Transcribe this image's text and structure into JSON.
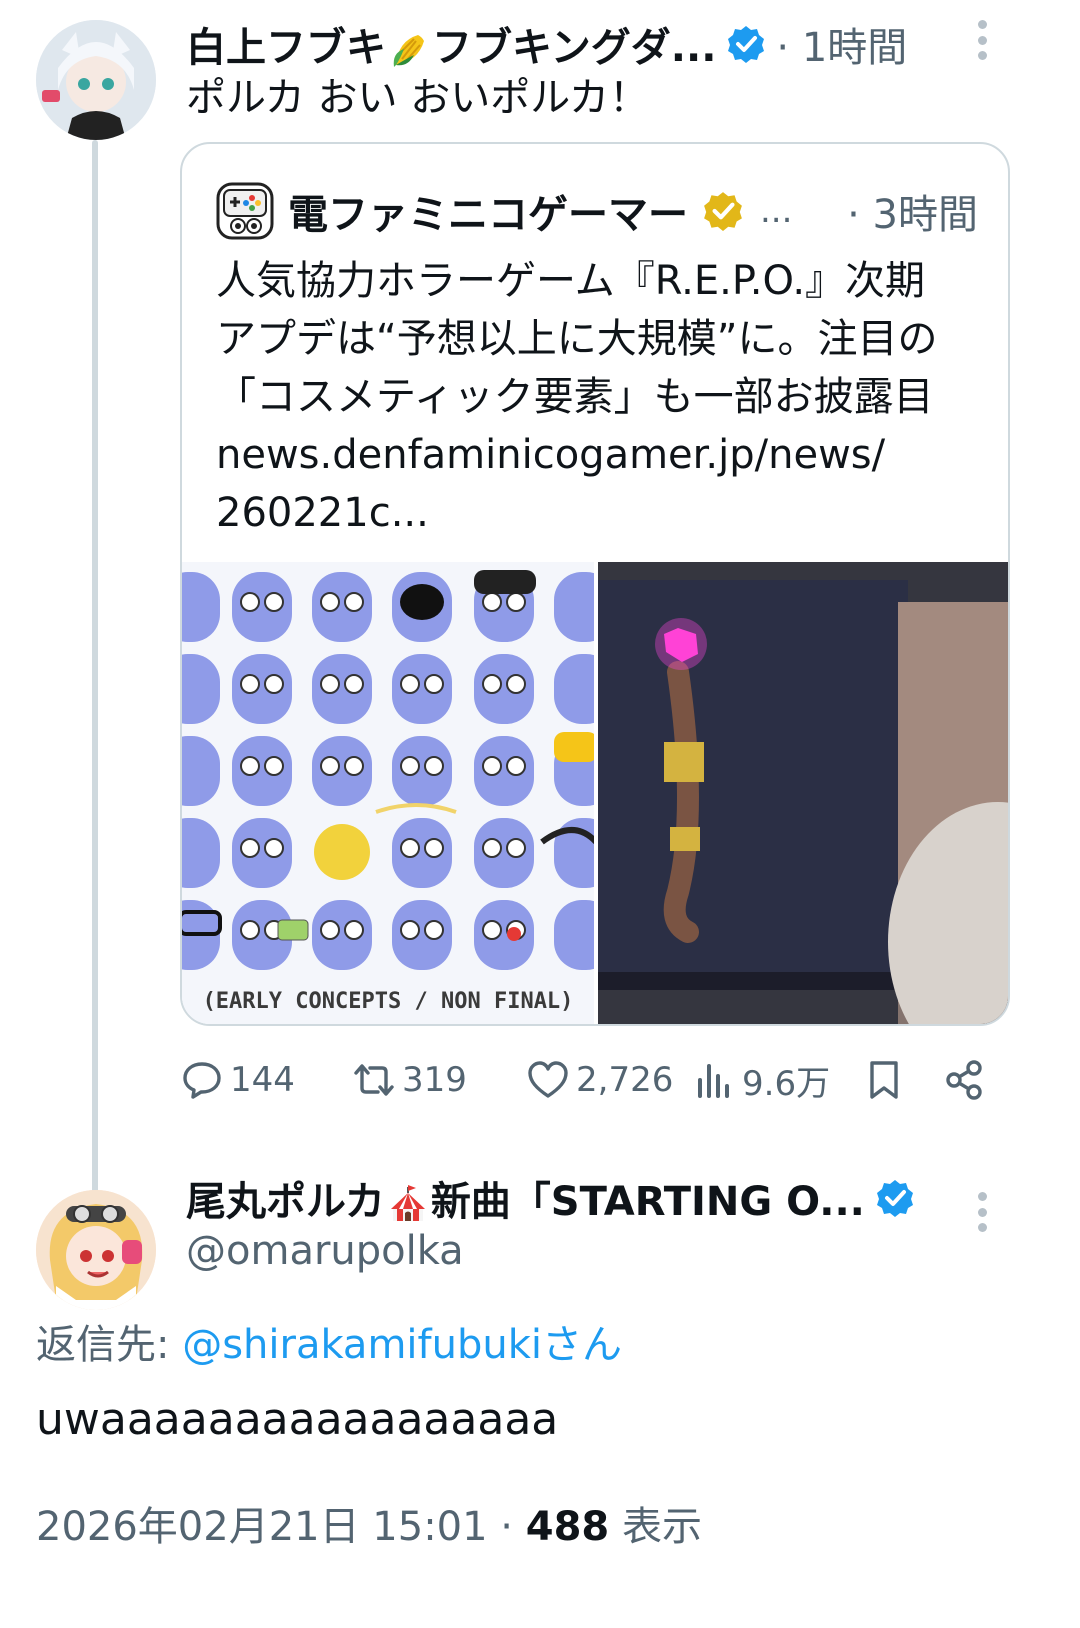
{
  "post1": {
    "display_name_a": "白上フブキ",
    "display_name_b": "フブキングダ...",
    "time": "· 1時間",
    "text": "ポルカ おい おいポルカ！"
  },
  "quote": {
    "display_name": "電ファミニコゲーマー",
    "dots": "...",
    "time": "· 3時間",
    "lines": [
      "人気協力ホラーゲーム『R.E.P.O.』次期",
      "アプデは“予想以上に大規模”に。注目の",
      "「コスメティック要素」も一部お披露目",
      "news.denfaminicogamer.jp/news/",
      "260221c..."
    ],
    "media_caption": "(EARLY CONCEPTS / NON FINAL)"
  },
  "actions": {
    "reply_count": "144",
    "repost_count": "319",
    "like_count": "2,726",
    "views_count": "9.6万"
  },
  "post2": {
    "display_name_a": "尾丸ポルカ",
    "display_name_b": "新曲「STARTING O...",
    "handle": "@omarupolka",
    "reply_label": "返信先: ",
    "reply_mention": "@shirakamifubukiさん",
    "text": "uwaaaaaaaaaaaaaaaaa",
    "date": "2026年02月21日 15:01 · ",
    "views": "488",
    "views_label": " 表示"
  },
  "colors": {
    "accent": "#1d9bf0",
    "muted": "#536471",
    "verified_gold": "#e2b719",
    "border": "#cfd9de"
  },
  "icons": [
    "reply-icon",
    "repost-icon",
    "like-icon",
    "views-icon",
    "bookmark-icon",
    "share-icon",
    "verified-badge-icon",
    "corn-emoji-icon",
    "circus-tent-emoji-icon"
  ]
}
